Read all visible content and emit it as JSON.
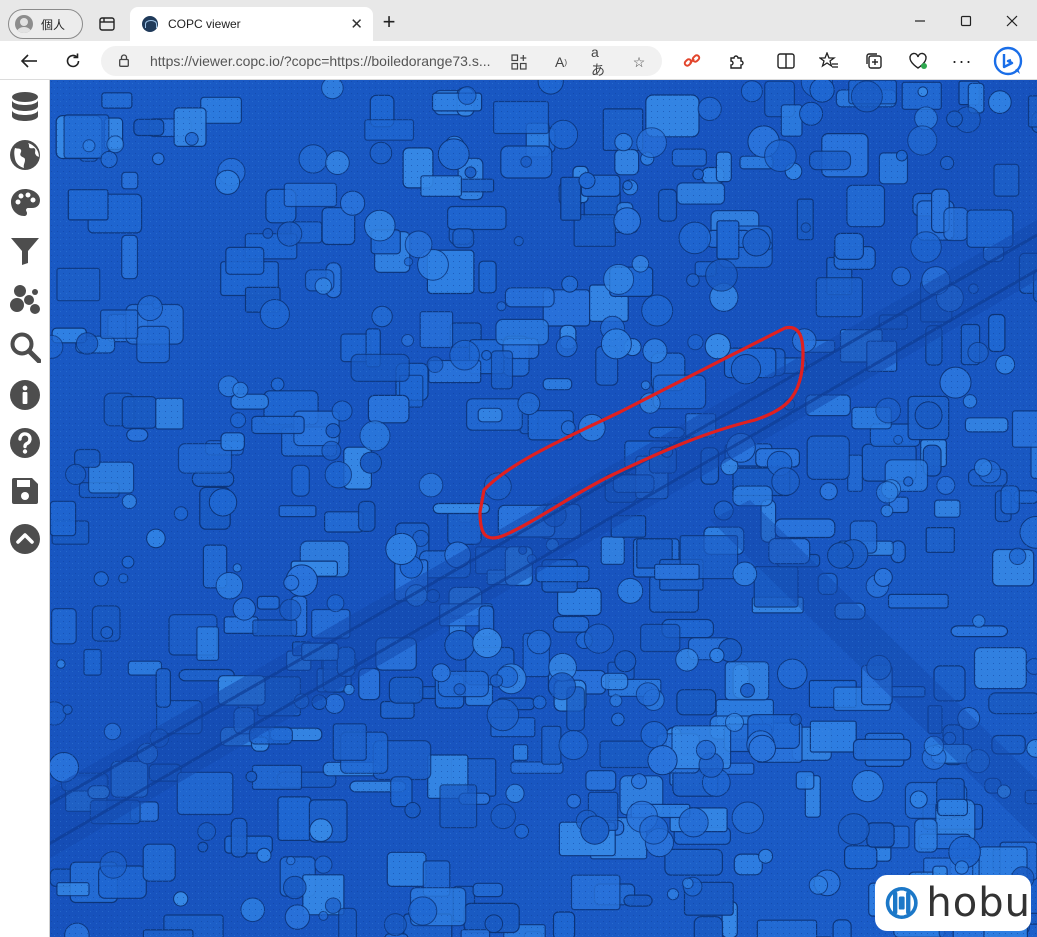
{
  "browser": {
    "profile_label": "個人",
    "tab": {
      "title": "COPC viewer"
    },
    "url": "https://viewer.copc.io/?copc=https://boiledorange73.s..."
  },
  "sidebar": {
    "items": [
      {
        "icon": "database-icon"
      },
      {
        "icon": "globe-icon"
      },
      {
        "icon": "palette-icon"
      },
      {
        "icon": "filter-icon"
      },
      {
        "icon": "point-cloud-icon"
      },
      {
        "icon": "search-icon"
      },
      {
        "icon": "info-icon"
      },
      {
        "icon": "help-icon"
      },
      {
        "icon": "save-icon"
      },
      {
        "icon": "chevron-up-icon"
      }
    ]
  },
  "viewer": {
    "colors": {
      "ground": "#1957c1",
      "dark": "#0d3a8f",
      "light": "#3a8fe6",
      "highlight": "#e02020"
    }
  },
  "logo": {
    "text": "hobu"
  }
}
